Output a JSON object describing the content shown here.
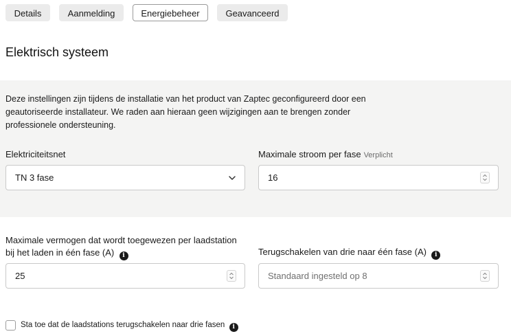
{
  "tabs": [
    {
      "label": "Details",
      "active": false
    },
    {
      "label": "Aanmelding",
      "active": false
    },
    {
      "label": "Energiebeheer",
      "active": true
    },
    {
      "label": "Geavanceerd",
      "active": false
    }
  ],
  "section_title": "Elektrisch systeem",
  "info_text": "Deze instellingen zijn tijdens de installatie van het product van Zaptec geconfigureerd door een geautoriseerde installateur. We raden aan hieraan geen wijzigingen aan te brengen zonder professionele ondersteuning.",
  "grid": {
    "label": "Elektriciteitsnet",
    "value": "TN 3 fase"
  },
  "max_current": {
    "label": "Maximale stroom per fase",
    "required": "Verplicht",
    "value": "16"
  },
  "max_power_single_phase": {
    "label_line1": "Maximale vermogen dat wordt toegewezen per laadstation",
    "label_line2": "bij het laden in één fase (A)",
    "value": "25"
  },
  "switch_back": {
    "label": "Terugschakelen van drie naar één fase (A)",
    "placeholder": "Standaard ingesteld op 8"
  },
  "allow_three_phase": {
    "label": "Sta toe dat de laadstations terugschakelen naar drie fasen",
    "checked": false
  },
  "icons": {
    "info": "info-icon",
    "chevron": "chevron-down-icon",
    "spinner": "spinner-icon"
  }
}
